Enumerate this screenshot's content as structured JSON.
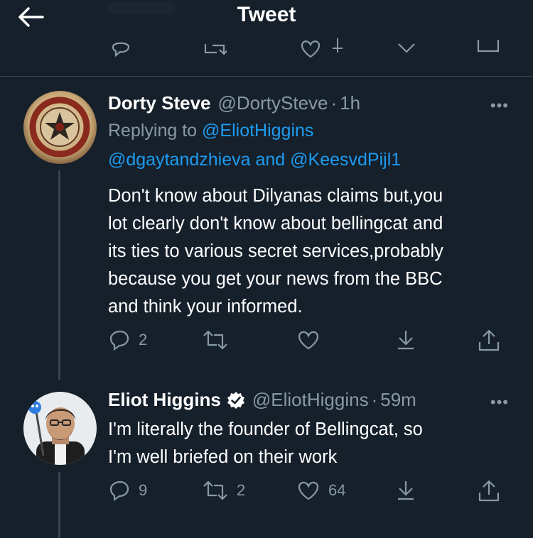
{
  "header": {
    "title": "Tweet"
  },
  "tweets": [
    {
      "name": "Dorty Steve",
      "handle": "@DortySteve",
      "separator": "·",
      "time": "1h",
      "replying_prefix": "Replying to",
      "replying_user1": "@EliotHiggins",
      "replying_user2": "@dgaytandzhieva",
      "replying_and": "and",
      "replying_user3": "@KeesvdPijl1",
      "lines": [
        "Don't know about Dilyanas claims but,you",
        "lot clearly don't know about bellingcat and",
        "its ties to various secret services,probably",
        "because you get your news from the BBC",
        "and think your informed."
      ],
      "reply_count": "2",
      "retweet_count": "",
      "like_count": ""
    },
    {
      "name": "Eliot Higgins",
      "handle": "@EliotHiggins",
      "separator": "·",
      "time": "59m",
      "verified": true,
      "lines": [
        "I'm literally the founder of Bellingcat, so",
        "I'm well briefed on their work"
      ],
      "reply_count": "9",
      "retweet_count": "2",
      "like_count": "64"
    }
  ],
  "more_label": "•••",
  "colors": {
    "background": "#15202b",
    "muted": "#8899a6",
    "link": "#1d9bf0",
    "divider": "#38444d"
  }
}
